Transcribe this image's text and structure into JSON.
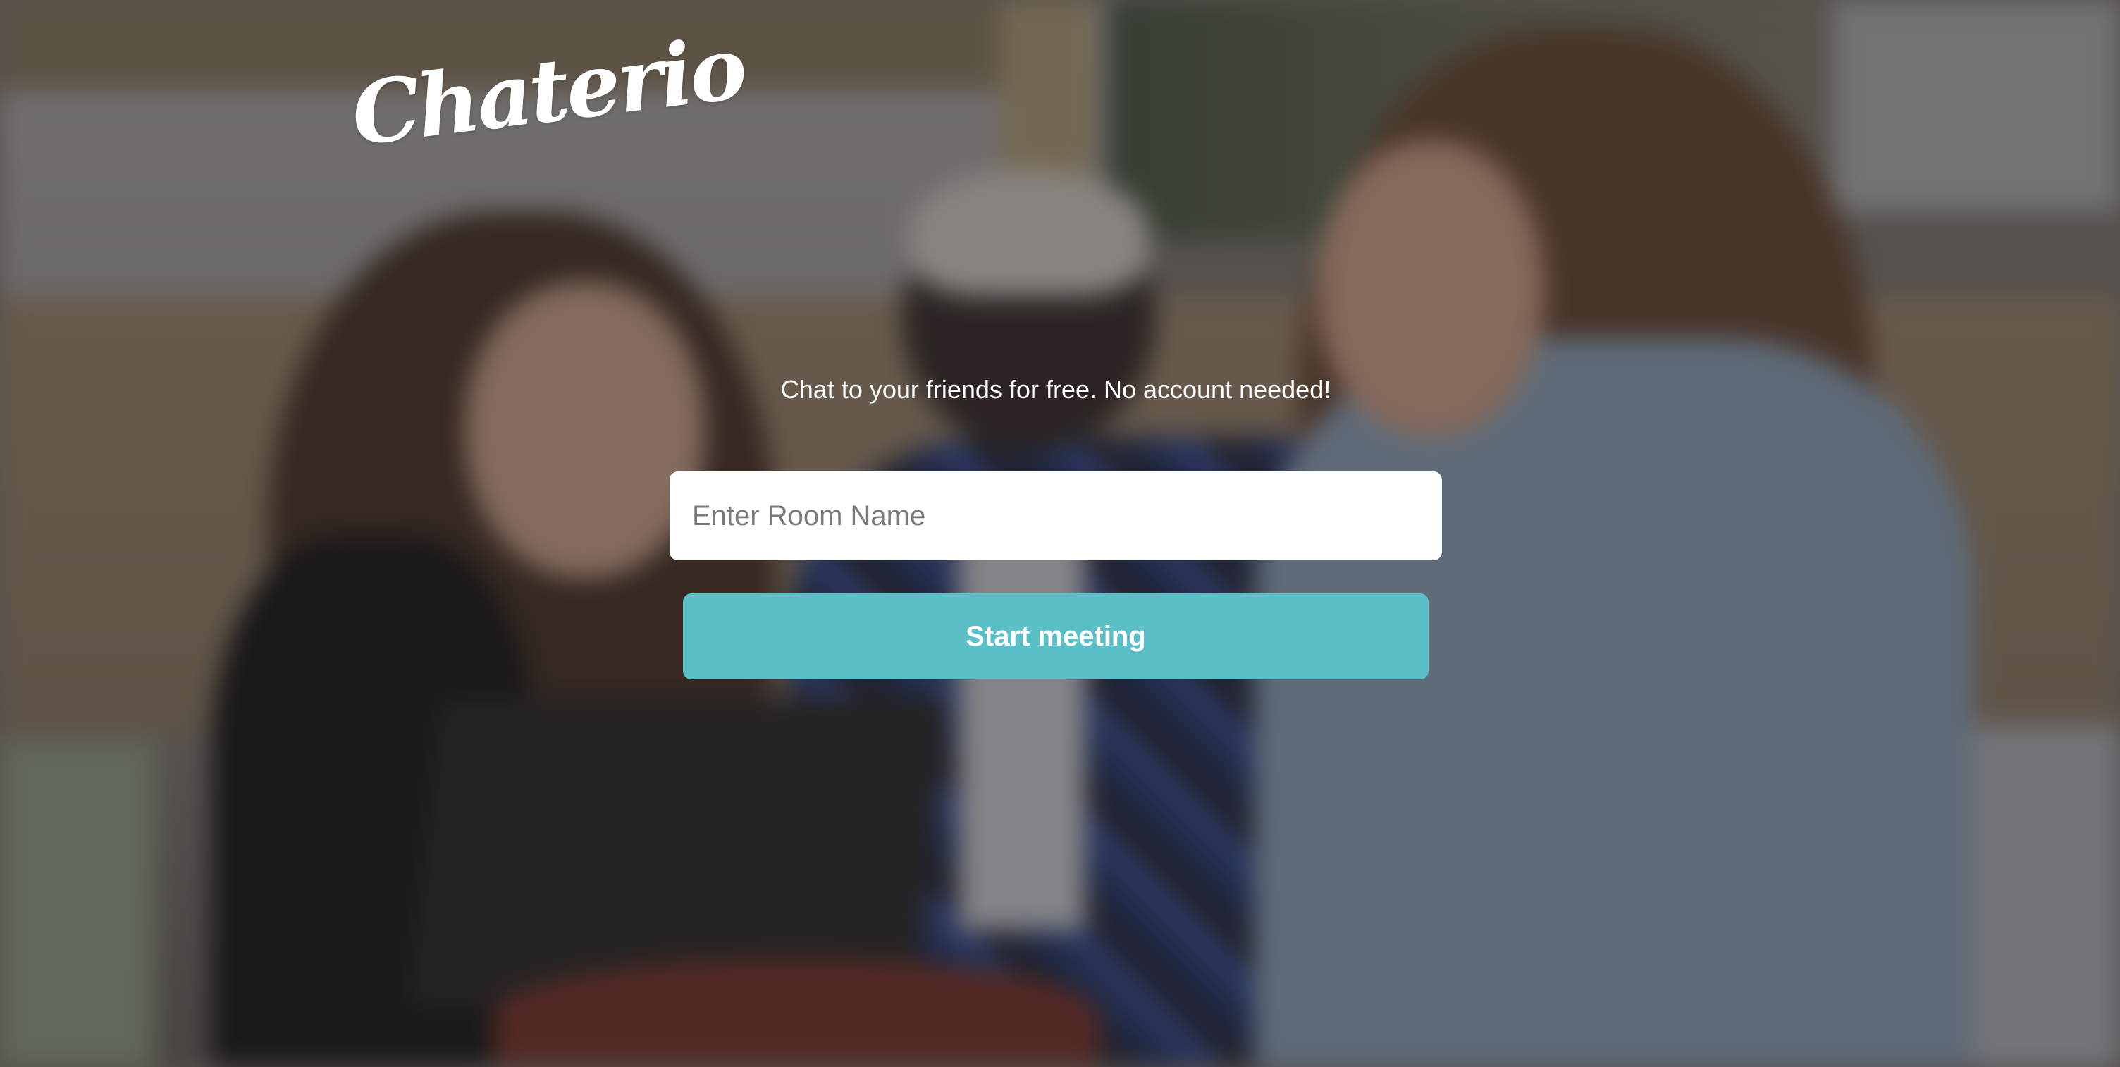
{
  "brand": {
    "logo_text": "Chaterio"
  },
  "hero": {
    "tagline": "Chat to your friends for free. No account needed!"
  },
  "room_form": {
    "input_placeholder": "Enter Room Name",
    "input_value": "",
    "submit_label": "Start meeting"
  },
  "colors": {
    "accent": "#5bbfc7",
    "text_light": "#ffffff",
    "input_bg": "#ffffff"
  }
}
